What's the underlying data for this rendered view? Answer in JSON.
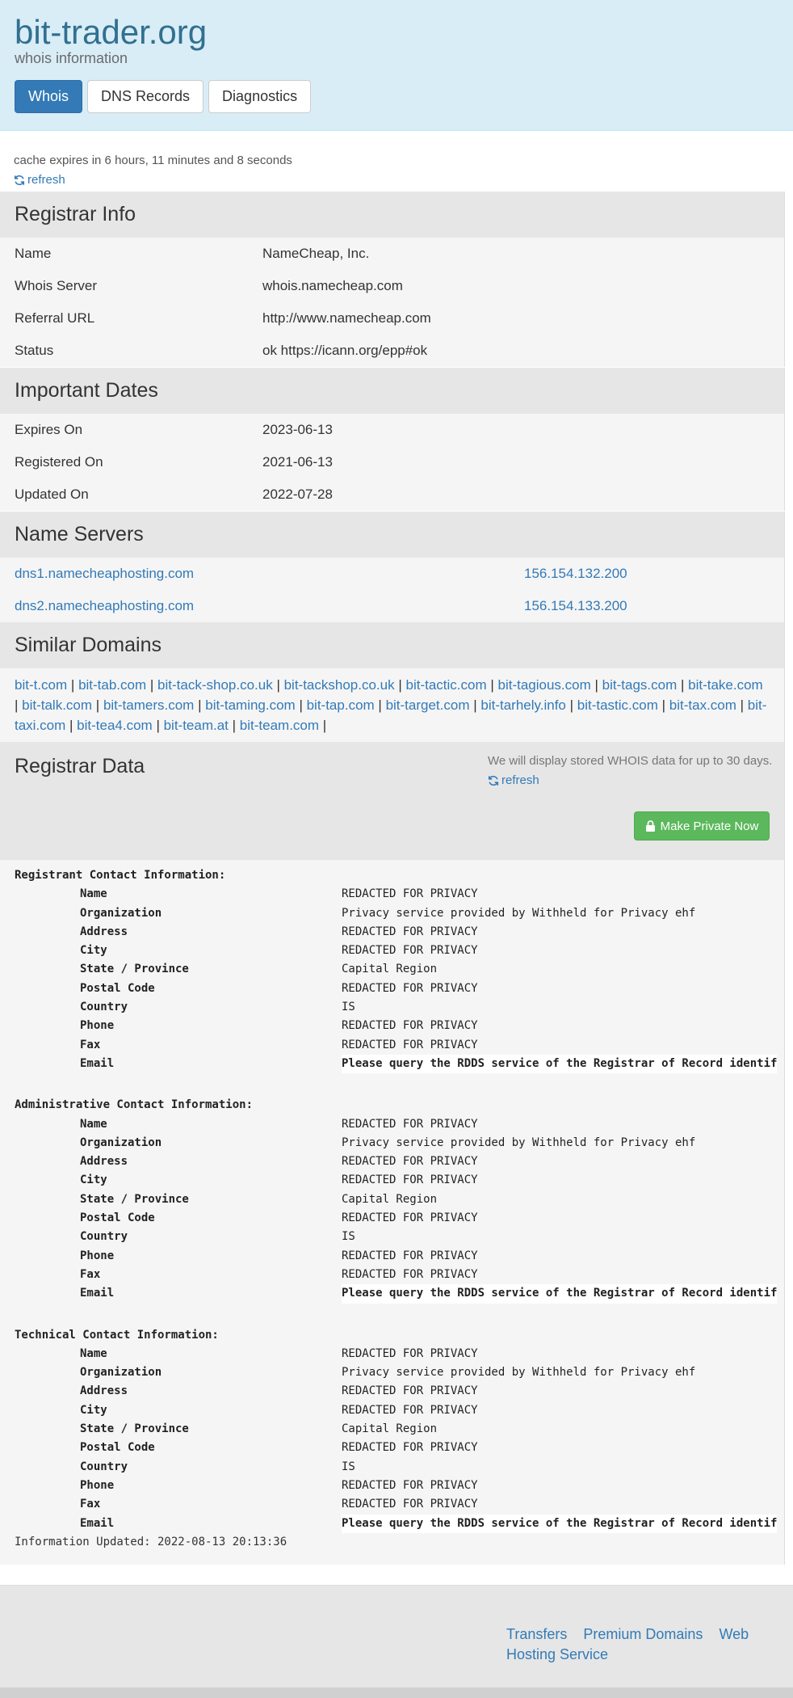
{
  "header": {
    "title": "bit-trader.org",
    "subtitle": "whois information",
    "tabs": [
      {
        "label": "Whois",
        "active": true
      },
      {
        "label": "DNS Records",
        "active": false
      },
      {
        "label": "Diagnostics",
        "active": false
      }
    ]
  },
  "cache": {
    "text": "cache expires in 6 hours, 11 minutes and 8 seconds",
    "refresh_label": "refresh"
  },
  "registrar_info": {
    "heading": "Registrar Info",
    "rows": [
      {
        "label": "Name",
        "value": "NameCheap, Inc."
      },
      {
        "label": "Whois Server",
        "value": "whois.namecheap.com"
      },
      {
        "label": "Referral URL",
        "value": "http://www.namecheap.com"
      },
      {
        "label": "Status",
        "value": "ok https://icann.org/epp#ok"
      }
    ]
  },
  "important_dates": {
    "heading": "Important Dates",
    "rows": [
      {
        "label": "Expires On",
        "value": "2023-06-13"
      },
      {
        "label": "Registered On",
        "value": "2021-06-13"
      },
      {
        "label": "Updated On",
        "value": "2022-07-28"
      }
    ]
  },
  "name_servers": {
    "heading": "Name Servers",
    "rows": [
      {
        "host": "dns1.namecheaphosting.com",
        "ip": "156.154.132.200"
      },
      {
        "host": "dns2.namecheaphosting.com",
        "ip": "156.154.133.200"
      }
    ]
  },
  "similar_domains": {
    "heading": "Similar Domains",
    "domains": [
      "bit-t.com",
      "bit-tab.com",
      "bit-tack-shop.co.uk",
      "bit-tackshop.co.uk",
      "bit-tactic.com",
      "bit-tagious.com",
      "bit-tags.com",
      "bit-take.com",
      "bit-talk.com",
      "bit-tamers.com",
      "bit-taming.com",
      "bit-tap.com",
      "bit-target.com",
      "bit-tarhely.info",
      "bit-tastic.com",
      "bit-tax.com",
      "bit-taxi.com",
      "bit-tea4.com",
      "bit-team.at",
      "bit-team.com"
    ]
  },
  "registrar_data": {
    "heading": "Registrar Data",
    "note": "We will display stored WHOIS data for up to 30 days.",
    "refresh_label": "refresh",
    "private_button": "Make Private Now",
    "contacts": [
      {
        "title": "Registrant Contact Information:",
        "rows": [
          {
            "label": "Name",
            "value": "REDACTED FOR PRIVACY"
          },
          {
            "label": "Organization",
            "value": "Privacy service provided by Withheld for Privacy ehf"
          },
          {
            "label": "Address",
            "value": "REDACTED FOR PRIVACY"
          },
          {
            "label": "City",
            "value": "REDACTED FOR PRIVACY"
          },
          {
            "label": "State / Province",
            "value": "Capital Region"
          },
          {
            "label": "Postal Code",
            "value": "REDACTED FOR PRIVACY"
          },
          {
            "label": "Country",
            "value": "IS"
          },
          {
            "label": "Phone",
            "value": "REDACTED FOR PRIVACY"
          },
          {
            "label": "Fax",
            "value": "REDACTED FOR PRIVACY"
          },
          {
            "label": "Email",
            "value": "Please query the RDDS service of the Registrar of Record identif"
          }
        ]
      },
      {
        "title": "Administrative Contact Information:",
        "rows": [
          {
            "label": "Name",
            "value": "REDACTED FOR PRIVACY"
          },
          {
            "label": "Organization",
            "value": "Privacy service provided by Withheld for Privacy ehf"
          },
          {
            "label": "Address",
            "value": "REDACTED FOR PRIVACY"
          },
          {
            "label": "City",
            "value": "REDACTED FOR PRIVACY"
          },
          {
            "label": "State / Province",
            "value": "Capital Region"
          },
          {
            "label": "Postal Code",
            "value": "REDACTED FOR PRIVACY"
          },
          {
            "label": "Country",
            "value": "IS"
          },
          {
            "label": "Phone",
            "value": "REDACTED FOR PRIVACY"
          },
          {
            "label": "Fax",
            "value": "REDACTED FOR PRIVACY"
          },
          {
            "label": "Email",
            "value": "Please query the RDDS service of the Registrar of Record identif"
          }
        ]
      },
      {
        "title": "Technical Contact Information:",
        "rows": [
          {
            "label": "Name",
            "value": "REDACTED FOR PRIVACY"
          },
          {
            "label": "Organization",
            "value": "Privacy service provided by Withheld for Privacy ehf"
          },
          {
            "label": "Address",
            "value": "REDACTED FOR PRIVACY"
          },
          {
            "label": "City",
            "value": "REDACTED FOR PRIVACY"
          },
          {
            "label": "State / Province",
            "value": "Capital Region"
          },
          {
            "label": "Postal Code",
            "value": "REDACTED FOR PRIVACY"
          },
          {
            "label": "Country",
            "value": "IS"
          },
          {
            "label": "Phone",
            "value": "REDACTED FOR PRIVACY"
          },
          {
            "label": "Fax",
            "value": "REDACTED FOR PRIVACY"
          },
          {
            "label": "Email",
            "value": "Please query the RDDS service of the Registrar of Record identif"
          }
        ]
      }
    ],
    "updated": "Information Updated: 2022-08-13 20:13:36"
  },
  "footer": {
    "links": [
      "Transfers",
      "Premium Domains",
      "Web Hosting Service"
    ]
  }
}
